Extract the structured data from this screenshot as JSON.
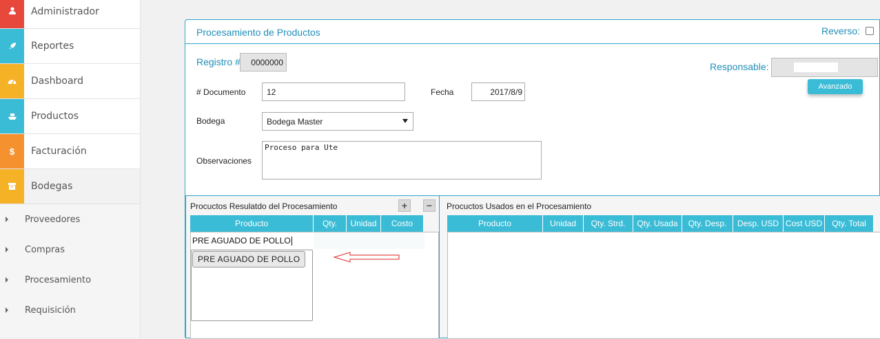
{
  "sidebar": {
    "items": [
      {
        "label": "Administrador",
        "icon": "user-icon",
        "color": "#e8473c"
      },
      {
        "label": "Reportes",
        "icon": "rocket-icon",
        "color": "#3bbcd6"
      },
      {
        "label": "Dashboard",
        "icon": "dashboard-icon",
        "color": "#f5b227"
      },
      {
        "label": "Productos",
        "icon": "ship-icon",
        "color": "#3bbcd6"
      },
      {
        "label": "Facturación",
        "icon": "dollar-icon",
        "color": "#f5912f"
      },
      {
        "label": "Bodegas",
        "icon": "archive-icon",
        "color": "#f5b227"
      }
    ],
    "sub_items": [
      "Proveedores",
      "Compras",
      "Procesamiento",
      "Requisición"
    ]
  },
  "panel": {
    "title": "Procesamiento de Productos",
    "reverso_label": "Reverso:"
  },
  "form": {
    "registro_label": "Registro #",
    "registro_value": "0000000",
    "responsable_label": "Responsable:",
    "avanzado_label": "Avanzado",
    "documento_label": "# Documento",
    "documento_value": "12",
    "fecha_label": "Fecha",
    "fecha_value": "2017/8/9",
    "bodega_label": "Bodega",
    "bodega_value": "Bodega Master",
    "observaciones_label": "Observaciones",
    "observaciones_value": "Proceso para Ute"
  },
  "resultado": {
    "title": "Procuctos Resulatdo del Procesamiento",
    "plus": "+",
    "minus": "−",
    "columns": [
      "Producto",
      "Qty.",
      "Unidad",
      "Costo"
    ],
    "input_value": "PRE AGUADO DE POLLO",
    "suggestion": "PRE AGUADO DE POLLO"
  },
  "usados": {
    "title": "Procuctos Usados en el Procesamiento",
    "columns": [
      "Producto",
      "Unidad",
      "Qty. Strd.",
      "Qty. Usada",
      "Qty. Desp.",
      "Desp. USD",
      "Cost USD",
      "Qty. Total"
    ]
  },
  "colors": {
    "accent": "#3bbcd6",
    "title_blue": "#1f8fb8",
    "arrow": "#d22"
  }
}
